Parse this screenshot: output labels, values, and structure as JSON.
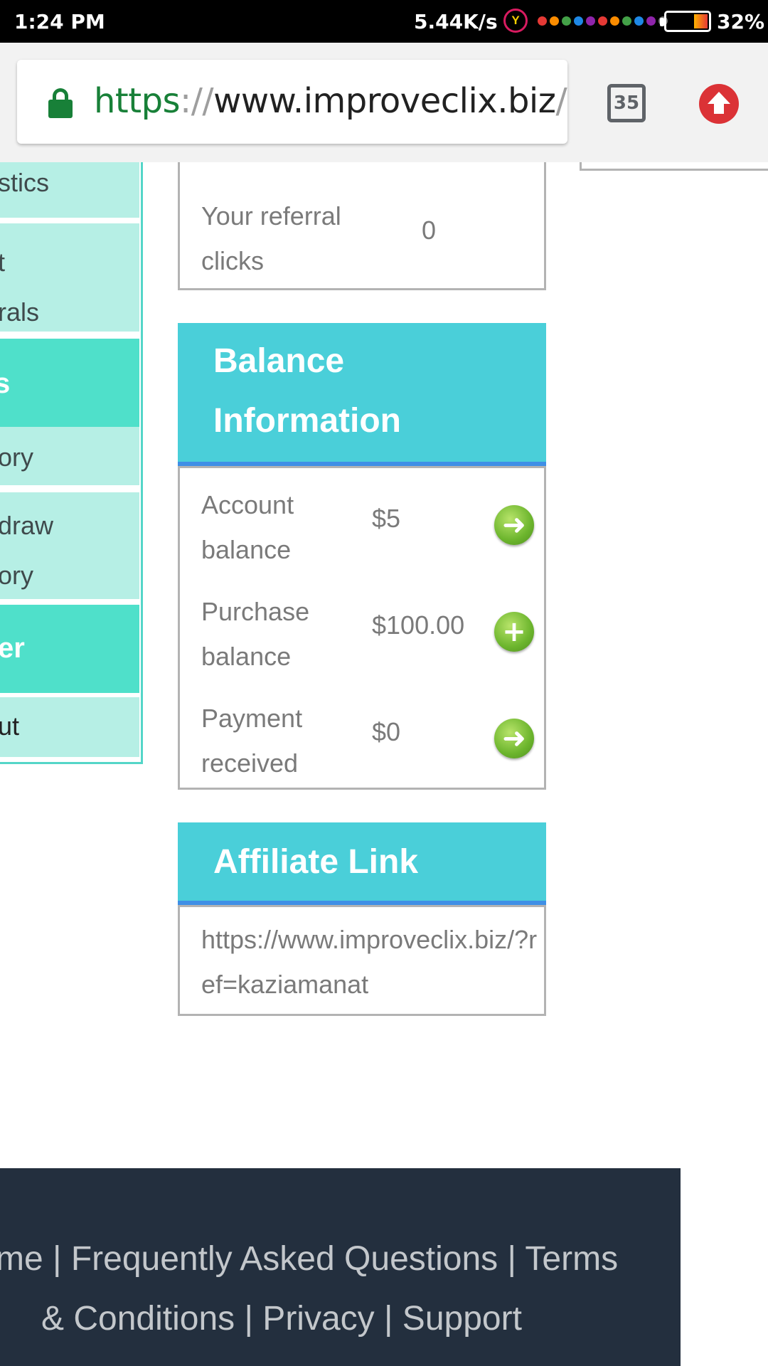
{
  "status_bar": {
    "time": "1:24 PM",
    "net_speed": "5.44K/s",
    "app_icon_letter": "Y",
    "battery": "32%",
    "battery_level": 0.32,
    "dot_colors": [
      "#e53935",
      "#fb8c00",
      "#43a047",
      "#1e88e5",
      "#8e24aa",
      "#e53935",
      "#fb8c00",
      "#43a047",
      "#1e88e5",
      "#8e24aa",
      "#757575"
    ]
  },
  "browser": {
    "url_scheme": "https",
    "url_sep": "://",
    "url_host": "www.improveclix.biz",
    "url_path": "/vi",
    "tab_count": "35",
    "secure": true
  },
  "sidebar": {
    "items": [
      {
        "line1": "stics"
      },
      {
        "line1": "t",
        "line2": "rals"
      },
      {
        "line1": "s",
        "heading": true
      },
      {
        "line1": "ory"
      },
      {
        "line1": "draw",
        "line2": "ory"
      },
      {
        "line1": "er",
        "heading": true
      },
      {
        "line1": "ut"
      }
    ]
  },
  "referral": {
    "label": "Your referral clicks",
    "value": "0"
  },
  "balance": {
    "title": "Balance Information",
    "rows": [
      {
        "label": "Account balance",
        "value": "$5",
        "action_icon": "arrow-right-icon",
        "glyph": "➜"
      },
      {
        "label": "Purchase balance",
        "value": "$100.00",
        "action_icon": "plus-icon",
        "glyph": "+"
      },
      {
        "label": "Payment received",
        "value": "$0",
        "action_icon": "arrow-right-icon",
        "glyph": "➜"
      }
    ]
  },
  "affiliate": {
    "title": "Affiliate Link",
    "link": "https://www.improveclix.biz/?ref=kaziamanat"
  },
  "footer": {
    "line1": "me | Frequently Asked Questions | Terms",
    "line2": "& Conditions | Privacy | Support"
  },
  "colors": {
    "header_teal": "#4acfd9",
    "header_underline": "#3f8fe6",
    "sidebar_item": "#b6efe5",
    "sidebar_heading": "#4fe0ca",
    "footer_bg": "#232f3e"
  }
}
